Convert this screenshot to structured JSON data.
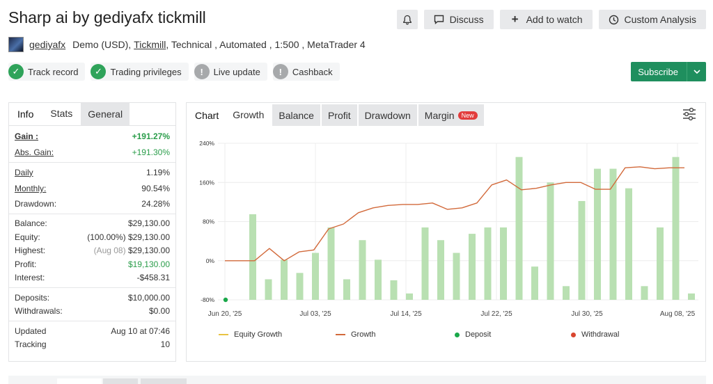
{
  "header": {
    "title": "Sharp ai by gediyafx tickmill"
  },
  "toolbar": {
    "notify_icon": "bell-icon",
    "discuss": "Discuss",
    "watch": "Add to watch",
    "custom": "Custom Analysis"
  },
  "meta": {
    "author": "gediyafx",
    "account_type": "Demo (USD),",
    "broker": "Tickmill",
    "details": ", Technical , Automated , 1:500 , MetaTrader 4"
  },
  "badges": [
    {
      "label": "Track record",
      "status": "ok"
    },
    {
      "label": "Trading privileges",
      "status": "ok"
    },
    {
      "label": "Live update",
      "status": "no"
    },
    {
      "label": "Cashback",
      "status": "no"
    }
  ],
  "subscribe": {
    "label": "Subscribe",
    "color": "#1f8f5e"
  },
  "left_panel": {
    "tabs": [
      "Info",
      "Stats",
      "General"
    ],
    "gain": {
      "label": "Gain :",
      "value": "+191.27%"
    },
    "abs_gain": {
      "label": "Abs. Gain:",
      "value": "+191.30%"
    },
    "daily": {
      "label": "Daily",
      "value": "1.19%"
    },
    "monthly": {
      "label": "Monthly:",
      "value": "90.54%"
    },
    "drawdown": {
      "label": "Drawdown:",
      "value": "24.28%"
    },
    "balance": {
      "label": "Balance:",
      "value": "$29,130.00"
    },
    "equity": {
      "label": "Equity:",
      "prefix": "(100.00%)",
      "value": "$29,130.00"
    },
    "highest": {
      "label": "Highest:",
      "prefix": "(Aug 08)",
      "value": "$29,130.00"
    },
    "profit": {
      "label": "Profit:",
      "value": "$19,130.00"
    },
    "interest": {
      "label": "Interest:",
      "value": "-$458.31"
    },
    "deposits": {
      "label": "Deposits:",
      "value": "$10,000.00"
    },
    "withdrawals": {
      "label": "Withdrawals:",
      "value": "$0.00"
    },
    "updated": {
      "label": "Updated",
      "value": "Aug 10 at 07:46"
    },
    "tracking": {
      "label": "Tracking",
      "value": "10"
    }
  },
  "right_panel": {
    "tabs": [
      "Chart",
      "Growth",
      "Balance",
      "Profit",
      "Drawdown",
      "Margin"
    ],
    "new_tag": "New",
    "filter_icon": "sliders-icon"
  },
  "chart_data": {
    "type": "bar",
    "ylim": [
      -80,
      240
    ],
    "yticks": [
      -80,
      0,
      80,
      160,
      240
    ],
    "ytick_labels": [
      "-80%",
      "0%",
      "80%",
      "160%",
      "240%"
    ],
    "x_tick_labels": [
      "Jun 20, '25",
      "Jul 03, '25",
      "Jul 14, '25",
      "Jul 22, '25",
      "Jul 30, '25",
      "Aug 08, '25"
    ],
    "grid": true,
    "legend": [
      "Equity Growth",
      "Growth",
      "Deposit",
      "Withdrawal"
    ],
    "legend_placement": "bottom",
    "colors": {
      "bars": "#b9e0b2",
      "growth": "#d2693a",
      "equity": "#e8c342",
      "deposit": "#1aa84a",
      "withdrawal": "#d9452e"
    },
    "bar_values": [
      95,
      -38,
      2,
      -25,
      16,
      68,
      -38,
      42,
      2,
      -40,
      -67,
      68,
      42,
      16,
      55,
      68,
      68,
      212,
      -12,
      160,
      -52,
      122,
      188,
      188,
      148,
      -52,
      68,
      212,
      -67
    ],
    "growth_values": [
      0,
      0,
      0,
      25,
      0,
      18,
      22,
      65,
      75,
      98,
      108,
      113,
      115,
      115,
      118,
      105,
      108,
      118,
      155,
      165,
      145,
      148,
      155,
      160,
      160,
      146,
      146,
      190,
      192,
      188,
      190,
      190
    ],
    "deposit_point": {
      "index": 0,
      "value": -80
    }
  }
}
